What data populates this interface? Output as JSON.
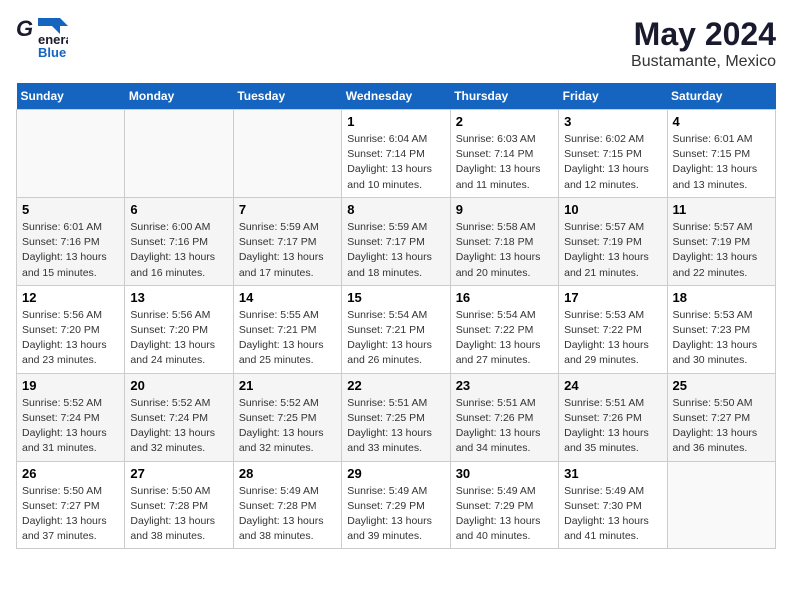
{
  "header": {
    "logo_top": "General",
    "logo_bot": "Blue",
    "month_year": "May 2024",
    "location": "Bustamante, Mexico"
  },
  "days_of_week": [
    "Sunday",
    "Monday",
    "Tuesday",
    "Wednesday",
    "Thursday",
    "Friday",
    "Saturday"
  ],
  "weeks": [
    [
      {
        "num": "",
        "info": ""
      },
      {
        "num": "",
        "info": ""
      },
      {
        "num": "",
        "info": ""
      },
      {
        "num": "1",
        "info": "Sunrise: 6:04 AM\nSunset: 7:14 PM\nDaylight: 13 hours\nand 10 minutes."
      },
      {
        "num": "2",
        "info": "Sunrise: 6:03 AM\nSunset: 7:14 PM\nDaylight: 13 hours\nand 11 minutes."
      },
      {
        "num": "3",
        "info": "Sunrise: 6:02 AM\nSunset: 7:15 PM\nDaylight: 13 hours\nand 12 minutes."
      },
      {
        "num": "4",
        "info": "Sunrise: 6:01 AM\nSunset: 7:15 PM\nDaylight: 13 hours\nand 13 minutes."
      }
    ],
    [
      {
        "num": "5",
        "info": "Sunrise: 6:01 AM\nSunset: 7:16 PM\nDaylight: 13 hours\nand 15 minutes."
      },
      {
        "num": "6",
        "info": "Sunrise: 6:00 AM\nSunset: 7:16 PM\nDaylight: 13 hours\nand 16 minutes."
      },
      {
        "num": "7",
        "info": "Sunrise: 5:59 AM\nSunset: 7:17 PM\nDaylight: 13 hours\nand 17 minutes."
      },
      {
        "num": "8",
        "info": "Sunrise: 5:59 AM\nSunset: 7:17 PM\nDaylight: 13 hours\nand 18 minutes."
      },
      {
        "num": "9",
        "info": "Sunrise: 5:58 AM\nSunset: 7:18 PM\nDaylight: 13 hours\nand 20 minutes."
      },
      {
        "num": "10",
        "info": "Sunrise: 5:57 AM\nSunset: 7:19 PM\nDaylight: 13 hours\nand 21 minutes."
      },
      {
        "num": "11",
        "info": "Sunrise: 5:57 AM\nSunset: 7:19 PM\nDaylight: 13 hours\nand 22 minutes."
      }
    ],
    [
      {
        "num": "12",
        "info": "Sunrise: 5:56 AM\nSunset: 7:20 PM\nDaylight: 13 hours\nand 23 minutes."
      },
      {
        "num": "13",
        "info": "Sunrise: 5:56 AM\nSunset: 7:20 PM\nDaylight: 13 hours\nand 24 minutes."
      },
      {
        "num": "14",
        "info": "Sunrise: 5:55 AM\nSunset: 7:21 PM\nDaylight: 13 hours\nand 25 minutes."
      },
      {
        "num": "15",
        "info": "Sunrise: 5:54 AM\nSunset: 7:21 PM\nDaylight: 13 hours\nand 26 minutes."
      },
      {
        "num": "16",
        "info": "Sunrise: 5:54 AM\nSunset: 7:22 PM\nDaylight: 13 hours\nand 27 minutes."
      },
      {
        "num": "17",
        "info": "Sunrise: 5:53 AM\nSunset: 7:22 PM\nDaylight: 13 hours\nand 29 minutes."
      },
      {
        "num": "18",
        "info": "Sunrise: 5:53 AM\nSunset: 7:23 PM\nDaylight: 13 hours\nand 30 minutes."
      }
    ],
    [
      {
        "num": "19",
        "info": "Sunrise: 5:52 AM\nSunset: 7:24 PM\nDaylight: 13 hours\nand 31 minutes."
      },
      {
        "num": "20",
        "info": "Sunrise: 5:52 AM\nSunset: 7:24 PM\nDaylight: 13 hours\nand 32 minutes."
      },
      {
        "num": "21",
        "info": "Sunrise: 5:52 AM\nSunset: 7:25 PM\nDaylight: 13 hours\nand 32 minutes."
      },
      {
        "num": "22",
        "info": "Sunrise: 5:51 AM\nSunset: 7:25 PM\nDaylight: 13 hours\nand 33 minutes."
      },
      {
        "num": "23",
        "info": "Sunrise: 5:51 AM\nSunset: 7:26 PM\nDaylight: 13 hours\nand 34 minutes."
      },
      {
        "num": "24",
        "info": "Sunrise: 5:51 AM\nSunset: 7:26 PM\nDaylight: 13 hours\nand 35 minutes."
      },
      {
        "num": "25",
        "info": "Sunrise: 5:50 AM\nSunset: 7:27 PM\nDaylight: 13 hours\nand 36 minutes."
      }
    ],
    [
      {
        "num": "26",
        "info": "Sunrise: 5:50 AM\nSunset: 7:27 PM\nDaylight: 13 hours\nand 37 minutes."
      },
      {
        "num": "27",
        "info": "Sunrise: 5:50 AM\nSunset: 7:28 PM\nDaylight: 13 hours\nand 38 minutes."
      },
      {
        "num": "28",
        "info": "Sunrise: 5:49 AM\nSunset: 7:28 PM\nDaylight: 13 hours\nand 38 minutes."
      },
      {
        "num": "29",
        "info": "Sunrise: 5:49 AM\nSunset: 7:29 PM\nDaylight: 13 hours\nand 39 minutes."
      },
      {
        "num": "30",
        "info": "Sunrise: 5:49 AM\nSunset: 7:29 PM\nDaylight: 13 hours\nand 40 minutes."
      },
      {
        "num": "31",
        "info": "Sunrise: 5:49 AM\nSunset: 7:30 PM\nDaylight: 13 hours\nand 41 minutes."
      },
      {
        "num": "",
        "info": ""
      }
    ]
  ]
}
